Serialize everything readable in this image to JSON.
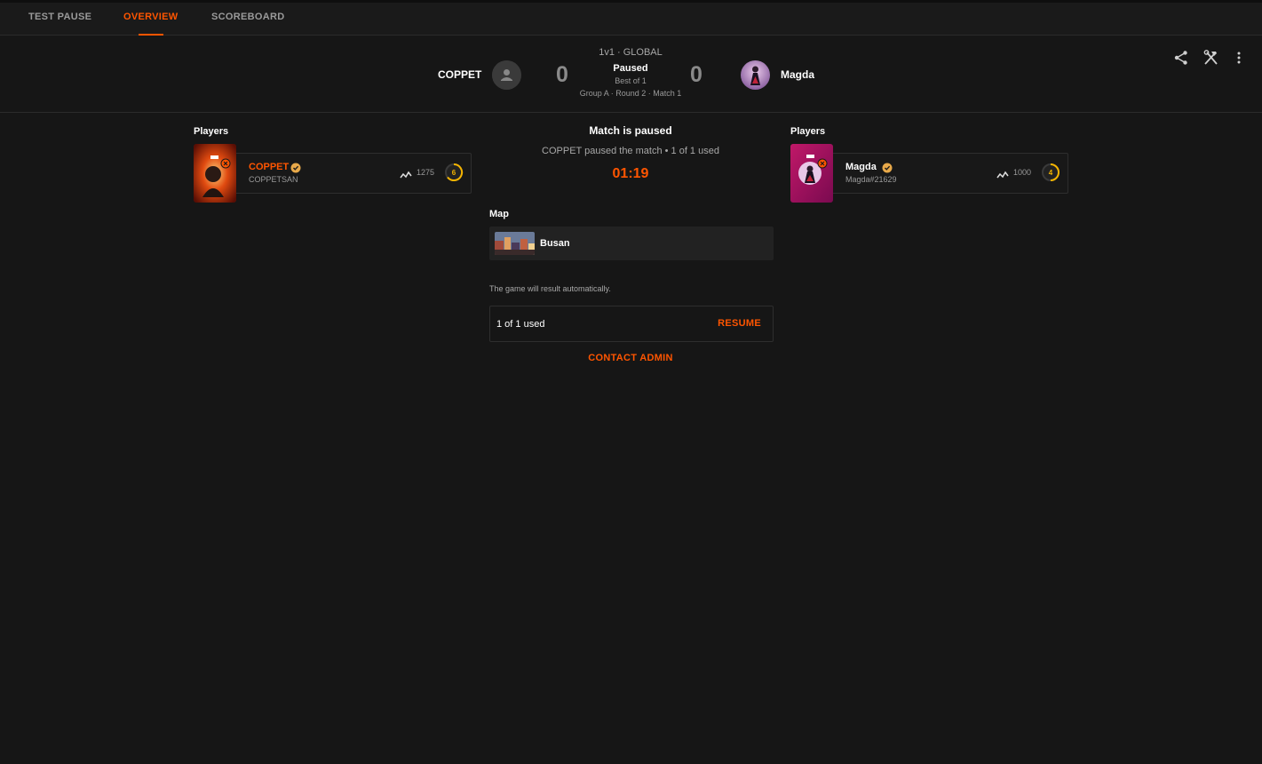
{
  "tabs": [
    {
      "label": "TEST PAUSE",
      "active": false
    },
    {
      "label": "OVERVIEW",
      "active": true
    },
    {
      "label": "SCOREBOARD",
      "active": false
    }
  ],
  "header": {
    "mode": "1v1 · GLOBAL",
    "team1": {
      "name": "COPPET",
      "score": "0"
    },
    "team2": {
      "name": "Magda",
      "score": "0"
    },
    "status": "Paused",
    "best_of": "Best of 1",
    "group_info": "Group A · Round 2 · Match 1",
    "icons": [
      "share-icon",
      "admin-tools-icon",
      "more-vertical-icon"
    ]
  },
  "left_players": {
    "title": "Players",
    "player": {
      "name": "COPPET",
      "account": "COPPETSAN",
      "elo": "1275",
      "level": "6",
      "name_color": "#ff5500"
    }
  },
  "right_players": {
    "title": "Players",
    "player": {
      "name": "Magda",
      "account": "Magda#21629",
      "elo": "1000",
      "level": "4",
      "name_color": "#ffffff"
    }
  },
  "pause": {
    "title": "Match is paused",
    "subtitle": "COPPET paused the match • 1 of 1 used",
    "timer": "01:19"
  },
  "map": {
    "title": "Map",
    "name": "Busan"
  },
  "auto_result_note": "The game will result automatically.",
  "pause_usage": {
    "used_text": "1 of 1 used",
    "resume_label": "RESUME"
  },
  "contact_admin_label": "CONTACT ADMIN",
  "colors": {
    "accent": "#ff5500",
    "background": "#161616",
    "level_ring": "#f5b400"
  }
}
